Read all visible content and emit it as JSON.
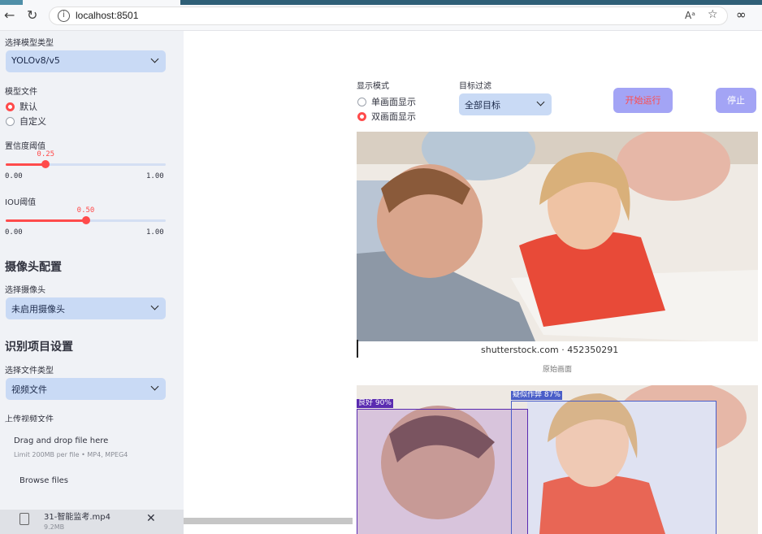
{
  "browser": {
    "url": "localhost:8501",
    "reader_icon": "Aᵃ",
    "star_icon": "☆",
    "ext_icon": "∞"
  },
  "sidebar": {
    "model_type_label": "选择模型类型",
    "model_type_value": "YOLOv8/v5",
    "model_file_label": "模型文件",
    "model_file_options": [
      "默认",
      "自定义"
    ],
    "model_file_selected": 0,
    "conf_label": "置信度阈值",
    "conf_value": "0.25",
    "conf_fraction": 0.25,
    "conf_min": "0.00",
    "conf_max": "1.00",
    "iou_label": "IOU阈值",
    "iou_value": "0.50",
    "iou_fraction": 0.5,
    "iou_min": "0.00",
    "iou_max": "1.00",
    "camera_heading": "摄像头配置",
    "camera_label": "选择摄像头",
    "camera_value": "未启用摄像头",
    "recog_heading": "识别项目设置",
    "file_type_label": "选择文件类型",
    "file_type_value": "视频文件",
    "upload_label": "上传视频文件",
    "upload_drop_text": "Drag and drop file here",
    "upload_limit_text": "Limit 200MB per file • MP4, MPEG4",
    "browse_label": "Browse files",
    "file_name": "31-智能监考.mp4",
    "file_size": "9.2MB"
  },
  "main": {
    "display_mode_label": "显示模式",
    "display_modes": [
      "单画面显示",
      "双画面显示"
    ],
    "display_mode_selected": 1,
    "target_filter_label": "目标过滤",
    "target_filter_value": "全部目标",
    "start_button": "开始运行",
    "stop_button": "停止",
    "watermark": "shutterstock.com · 452350291",
    "original_caption": "原始画面",
    "detections": [
      {
        "label": "良好 90%",
        "color": "#5a2bb0"
      },
      {
        "label": "疑似作弊 87%",
        "color": "#4a5ec8"
      }
    ]
  },
  "colors": {
    "accent": "#ff4b4b",
    "sidebar_bg": "#f0f2f6",
    "select_bg": "#c9daf5",
    "button_bg": "#a3a4f5"
  }
}
